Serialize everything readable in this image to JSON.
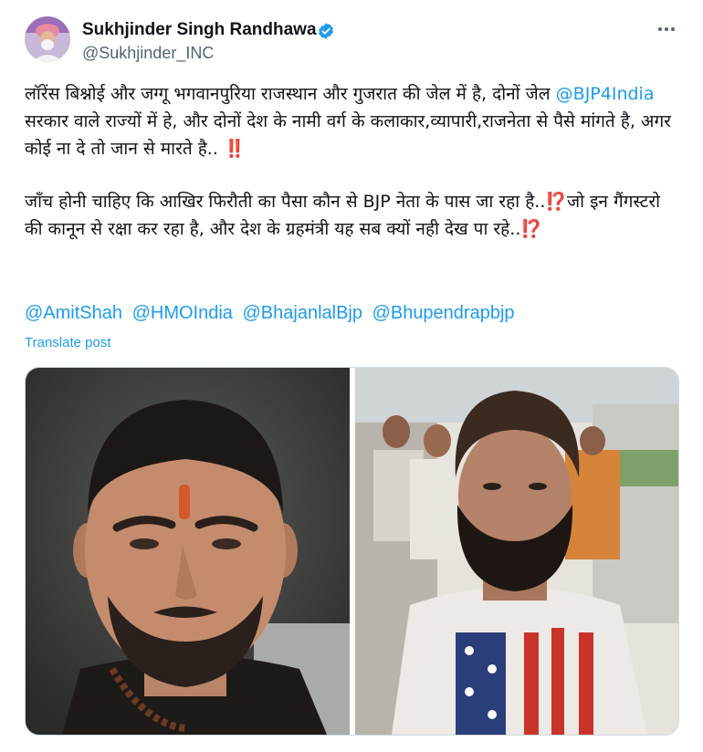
{
  "author": {
    "display_name": "Sukhjinder Singh Randhawa",
    "handle": "@Sukhjinder_INC",
    "verified": true,
    "avatar_icon": "profile-avatar"
  },
  "more_icon": "more-options-icon",
  "post": {
    "para1_part1": "लॉरेंस बिश्नोई और जग्गू भगवानपुरिया राजस्थान और गुजरात की जेल में है, दोनों जेल ",
    "para1_mention": "@BJP4India",
    "para1_part2": " सरकार वाले राज्यों में हे, और दोनों देश के नामी वर्ग के कलाकार,व्यापारी,राजनेता से पैसे मांगते है, अगर कोई ना दे तो जान से मारते है.. ",
    "para1_emoji": "‼️",
    "para2_part1": "जाँच होनी चाहिए कि आखिर फिरौती का पैसा कौन से BJP नेता के पास जा रहा है..",
    "para2_emoji1": "⁉️",
    "para2_part2": "जो इन गैंगस्टरो की कानून से रक्षा कर रहा है, और देश के ग्रहमंत्री यह सब क्यों नही देख पा रहे..",
    "para2_emoji2": "⁉️",
    "mentions": [
      "@AmitShah",
      "@HMOIndia",
      "@BhajanlalBjp",
      "@Bhupendrapbjp"
    ],
    "translate_label": "Translate post"
  },
  "media": {
    "left_photo": "man-with-tilak-photo",
    "right_photo": "bearded-man-stars-shirt-photo"
  },
  "colors": {
    "link": "#1d9bf0",
    "text": "#0f1419",
    "secondary": "#536471",
    "verified": "#1d9bf0"
  }
}
